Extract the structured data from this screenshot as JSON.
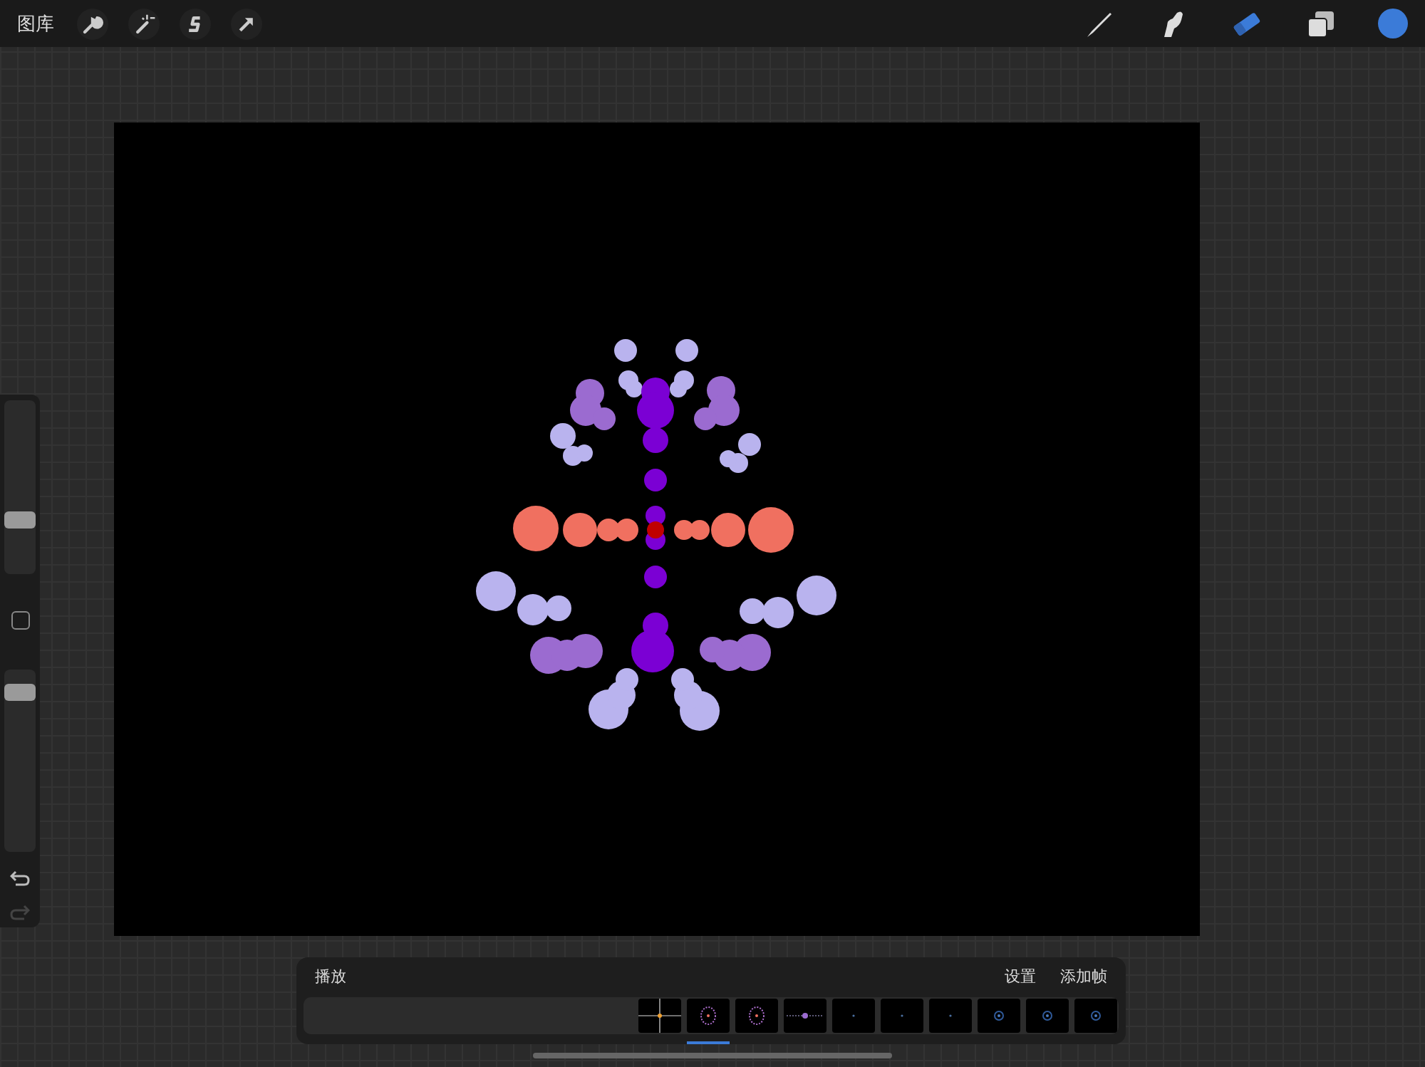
{
  "top_bar": {
    "gallery": "图库",
    "tools": [
      {
        "kind": "brush",
        "selected": false
      },
      {
        "kind": "smudge",
        "selected": false
      },
      {
        "kind": "eraser",
        "selected": true
      },
      {
        "kind": "layers",
        "selected": false
      }
    ],
    "color_swatch": {
      "color": "#3b7bd8"
    }
  },
  "sidebar": {
    "brush_size": {
      "level": 0.3
    },
    "opacity": {
      "level": 0.93
    },
    "redo_disabled": true
  },
  "timeline": {
    "play": "播放",
    "settings": "设置",
    "add_frame": "添加帧",
    "frames": [
      {
        "kind": "cross",
        "selected": false
      },
      {
        "kind": "figure",
        "selected": true
      },
      {
        "kind": "figure",
        "selected": false
      },
      {
        "kind": "line",
        "selected": false
      },
      {
        "kind": "dot",
        "selected": false
      },
      {
        "kind": "dot",
        "selected": false
      },
      {
        "kind": "dot",
        "selected": false
      },
      {
        "kind": "ring",
        "selected": false
      },
      {
        "kind": "ring",
        "selected": false
      },
      {
        "kind": "ring",
        "selected": false
      }
    ]
  }
}
